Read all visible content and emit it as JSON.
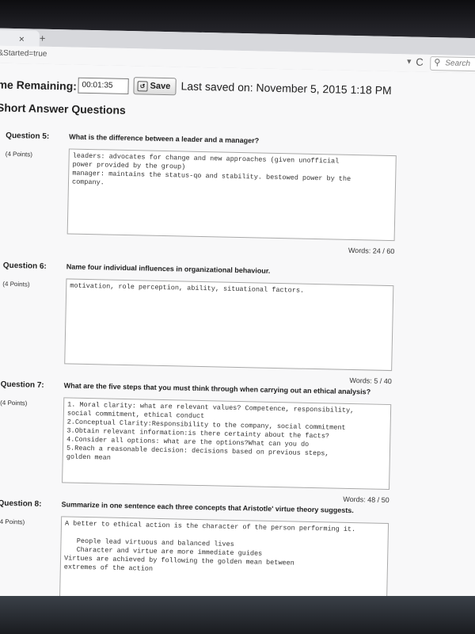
{
  "browser": {
    "url_fragment": "&Started=true",
    "tab_close": "×",
    "new_tab": "+",
    "dropdown_glyph": "▼",
    "reload_glyph": "C",
    "search_placeholder": "Search"
  },
  "header": {
    "time_label": "me Remaining:",
    "time_value": "00:01:35",
    "save_label": "Save",
    "last_saved": "Last saved on: November 5, 2015 1:18 PM"
  },
  "section_title": "Short Answer Questions",
  "questions": [
    {
      "number": "Question 5:",
      "points": "(4 Points)",
      "text": "What is the difference between a leader and a manager?",
      "answer": "leaders: advocates for change and new approaches (given unofficial\npower provided by the group)\nmanager: maintains the status-qo and stability. bestowed power by the\ncompany.",
      "words": "Words: 24 / 60"
    },
    {
      "number": "Question 6:",
      "points": "(4 Points)",
      "text": "Name four individual influences in organizational behaviour.",
      "answer": "motivation, role perception, ability, situational factors.",
      "words": "Words: 5 / 40"
    },
    {
      "number": "Question 7:",
      "points": "(4 Points)",
      "text": "What are the five steps that you must think through when carrying out an ethical analysis?",
      "answer": "1. Moral clarity: what are relevant values? Competence, responsibility,\nsocial commitment, ethical conduct\n2.Conceptual Clarity:Responsibility to the company, social commitment\n3.Obtain relevant information:is there certainty about the facts?\n4.Consider all options: what are the options?What can you do\n5.Reach a reasonable decision: decisions based on previous steps,\ngolden mean",
      "words": "Words: 48 / 50"
    },
    {
      "number": "Question 8:",
      "points": "(4 Points)",
      "text": "Summarize in one sentence each three concepts that Aristotle' virtue theory suggests.",
      "answer": "A better to ethical action is the character of the person performing it.\n\n   People lead virtuous and balanced lives\n   Character and virtue are more immediate guides\nVirtues are achieved by following the golden mean between\nextremes of the action",
      "words": ""
    }
  ]
}
